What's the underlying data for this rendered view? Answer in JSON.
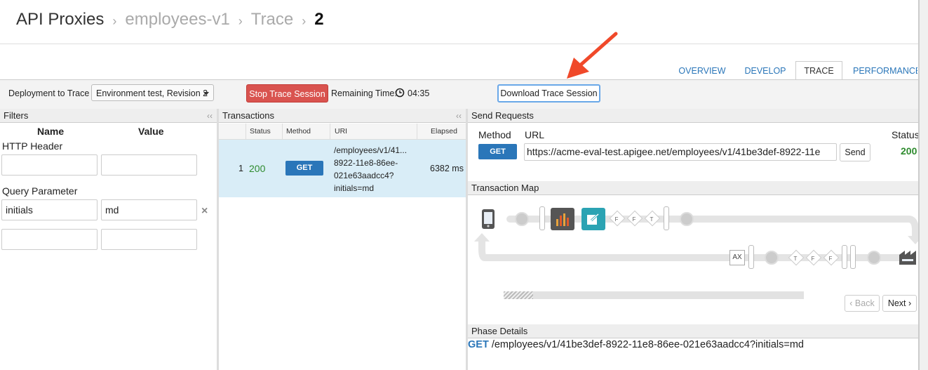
{
  "breadcrumb": {
    "root": "API Proxies",
    "proxy": "employees-v1",
    "section": "Trace",
    "current": "2",
    "separator": "›"
  },
  "tabs": [
    {
      "label": "OVERVIEW"
    },
    {
      "label": "DEVELOP"
    },
    {
      "label": "TRACE"
    },
    {
      "label": "PERFORMANCE"
    }
  ],
  "toolbar": {
    "deployment_label": "Deployment to Trace",
    "deployment_value": "Environment test, Revision 2",
    "stop_label": "Stop Trace Session",
    "remaining_label": "Remaining Time:",
    "remaining_value": "04:35",
    "download_label": "Download Trace Session"
  },
  "filters": {
    "title": "Filters",
    "collapse": "‹‹",
    "name_header": "Name",
    "value_header": "Value",
    "http_header_label": "HTTP Header",
    "query_param_label": "Query Parameter",
    "query_name": "initials",
    "query_value": "md",
    "remove": "×"
  },
  "transactions": {
    "title": "Transactions",
    "collapse": "‹‹",
    "columns": {
      "status": "Status",
      "method": "Method",
      "uri": "URI",
      "elapsed": "Elapsed"
    },
    "row": {
      "index": "1",
      "status": "200",
      "method": "GET",
      "uri_lines": [
        "/employees/v1/41...",
        "8922-11e8-86ee-",
        "021e63aadcc4?",
        "initials=md"
      ],
      "elapsed": "6382 ms"
    }
  },
  "send_requests": {
    "title": "Send Requests",
    "method_label": "Method",
    "url_label": "URL",
    "status_label": "Status",
    "method": "GET",
    "url": "https://acme-eval-test.apigee.net/employees/v1/41be3def-8922-11e",
    "send_label": "Send",
    "status_value": "200"
  },
  "transaction_map": {
    "title": "Transaction Map",
    "flags_top": [
      "F",
      "F",
      "T"
    ],
    "flags_bottom": [
      "T",
      "F",
      "F"
    ],
    "ax_label": "AX",
    "back_label": "Back",
    "next_label": "Next"
  },
  "phase_details": {
    "title": "Phase Details",
    "method": "GET",
    "path": "/employees/v1/41be3def-8922-11e8-86ee-021e63aadcc4?initials=md"
  },
  "colors": {
    "accent": "#2a76b9",
    "danger": "#d9534f",
    "success": "#2e8b2e",
    "selected_row": "#d9edf7",
    "annotation_arrow": "#f0492a"
  }
}
